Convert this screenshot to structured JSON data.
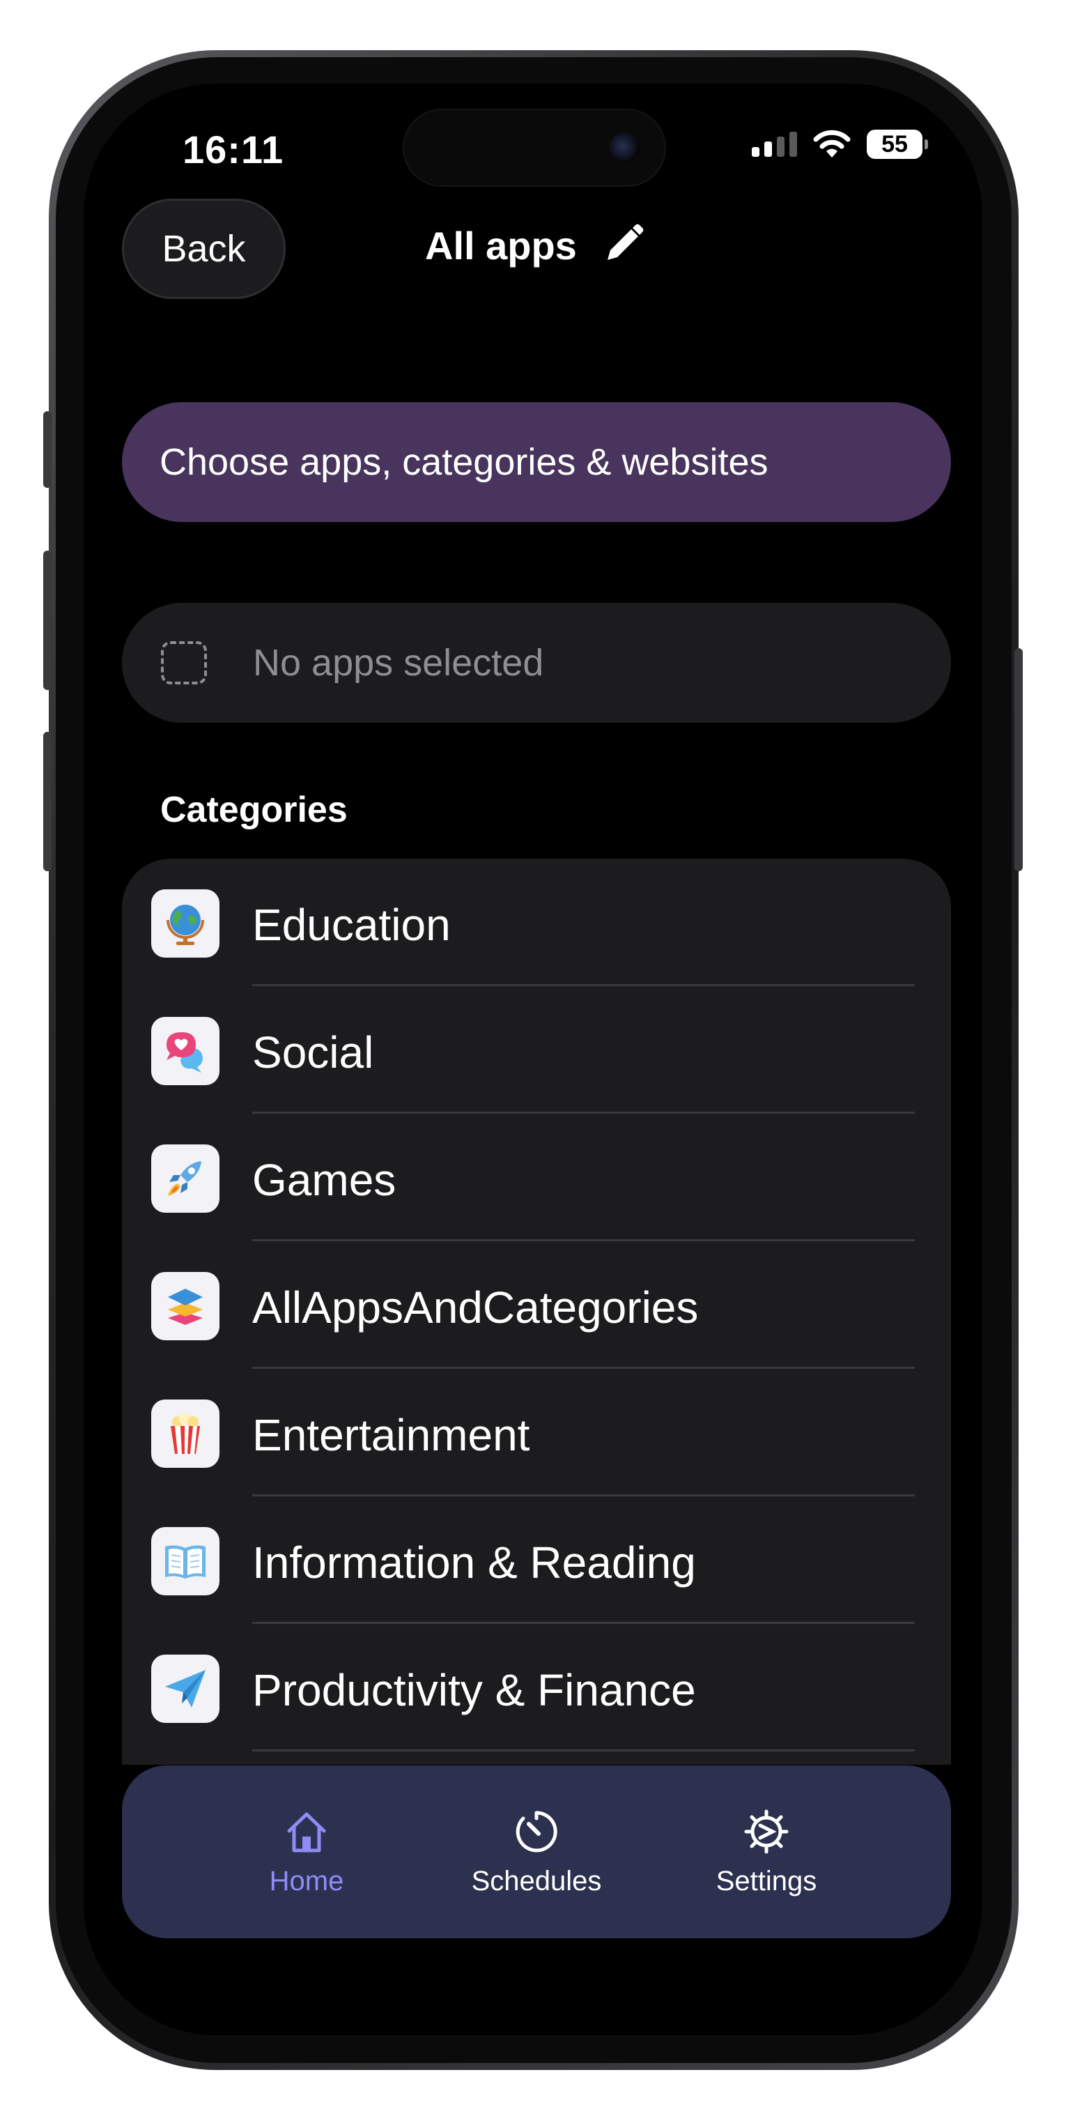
{
  "status_bar": {
    "time": "16:11",
    "battery": "55"
  },
  "nav": {
    "back_label": "Back",
    "title": "All apps"
  },
  "choose_button": {
    "label": "Choose apps, categories & websites"
  },
  "selection": {
    "empty_label": "No apps selected"
  },
  "categories": {
    "header": "Categories",
    "items": [
      {
        "label": "Education",
        "icon": "globe-icon"
      },
      {
        "label": "Social",
        "icon": "chat-bubbles-icon"
      },
      {
        "label": "Games",
        "icon": "rocket-icon"
      },
      {
        "label": "AllAppsAndCategories",
        "icon": "stack-icon"
      },
      {
        "label": "Entertainment",
        "icon": "popcorn-icon"
      },
      {
        "label": "Information & Reading",
        "icon": "book-icon"
      },
      {
        "label": "Productivity & Finance",
        "icon": "paper-plane-icon"
      }
    ]
  },
  "tab_bar": {
    "tabs": [
      {
        "label": "Home",
        "icon": "house-icon",
        "active": true
      },
      {
        "label": "Schedules",
        "icon": "timer-icon",
        "active": false
      },
      {
        "label": "Settings",
        "icon": "gear-icon",
        "active": false
      }
    ]
  },
  "colors": {
    "accent": "#8f8cf5",
    "choose_button_bg": "#48345c",
    "tab_bar_bg": "#2c3150",
    "card_bg": "#1c1c1e"
  }
}
